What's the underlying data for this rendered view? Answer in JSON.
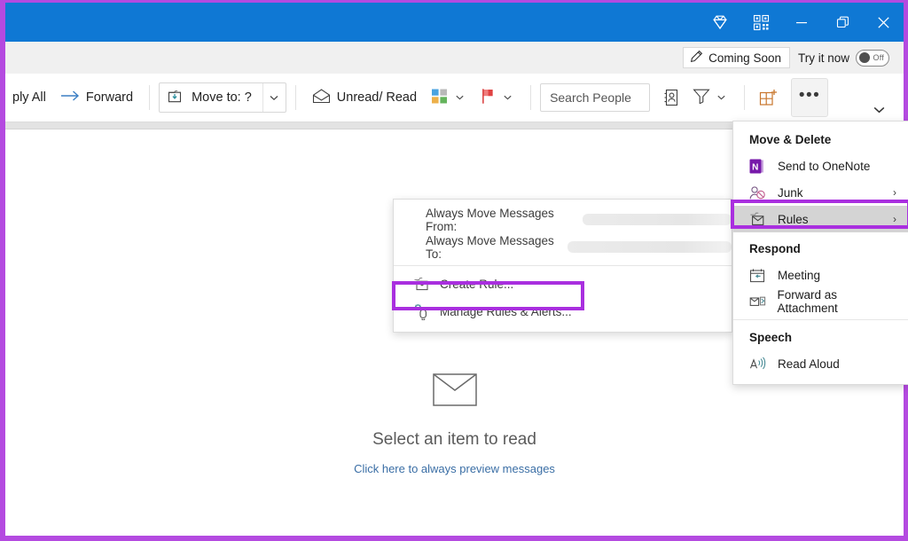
{
  "titlebar": {
    "buttons": [
      {
        "name": "diamond-icon",
        "label": "Upgrade"
      },
      {
        "name": "qr-code-icon",
        "label": "Mobile App"
      },
      {
        "name": "minimize-button",
        "label": "Minimize"
      },
      {
        "name": "restore-button",
        "label": "Restore"
      },
      {
        "name": "close-button",
        "label": "Close"
      }
    ],
    "background": "#0f78d4"
  },
  "coming_soon": {
    "badge": "Coming Soon",
    "try_it_now": "Try it now",
    "toggle_state": "Off"
  },
  "ribbon": {
    "reply_all": "ply All",
    "forward": "Forward",
    "move_to": "Move to: ?",
    "unread_read": "Unread/ Read",
    "categorize": "Categorize",
    "flag": "Follow Up",
    "search_people_placeholder": "Search People",
    "address_book": "Address Book",
    "filter_email": "Filter Email",
    "get_addins": "Get Add-ins",
    "more_commands": "•••",
    "expand_ribbon": "Expand the Ribbon"
  },
  "reading_pane": {
    "empty_title": "Select an item to read",
    "empty_link": "Click here to always preview messages",
    "envelope_icon": "envelope-icon"
  },
  "menu": {
    "sections": [
      {
        "header": "Move & Delete",
        "items": [
          {
            "label": "Send to OneNote",
            "icon": "onenote-icon",
            "has_submenu": false
          },
          {
            "label": "Junk",
            "icon": "junk-icon",
            "has_submenu": true,
            "arrow": "›"
          },
          {
            "label": "Rules",
            "icon": "rules-icon",
            "has_submenu": true,
            "arrow": "›",
            "highlighted": true
          }
        ]
      },
      {
        "header": "Respond",
        "items": [
          {
            "label": "Meeting",
            "icon": "meeting-icon",
            "has_submenu": false
          },
          {
            "label": "Forward as Attachment",
            "icon": "forward-attachment-icon",
            "has_submenu": false
          }
        ]
      },
      {
        "header": "Speech",
        "items": [
          {
            "label": "Read Aloud",
            "icon": "read-aloud-icon",
            "has_submenu": false
          }
        ]
      }
    ]
  },
  "submenu": {
    "items": [
      {
        "label": "Always Move Messages From:",
        "redacted": true,
        "redact_width": 180
      },
      {
        "label": "Always Move Messages To:",
        "redacted": true,
        "redact_width": 200
      },
      {
        "label": "Create Rule...",
        "icon": "create-rule-icon"
      },
      {
        "label": "Manage Rules & Alerts...",
        "icon": "manage-rules-icon",
        "highlighted": true
      }
    ]
  },
  "annotations": {
    "highlight_color": "#a92fdf",
    "border_color": "#b44ae0"
  }
}
